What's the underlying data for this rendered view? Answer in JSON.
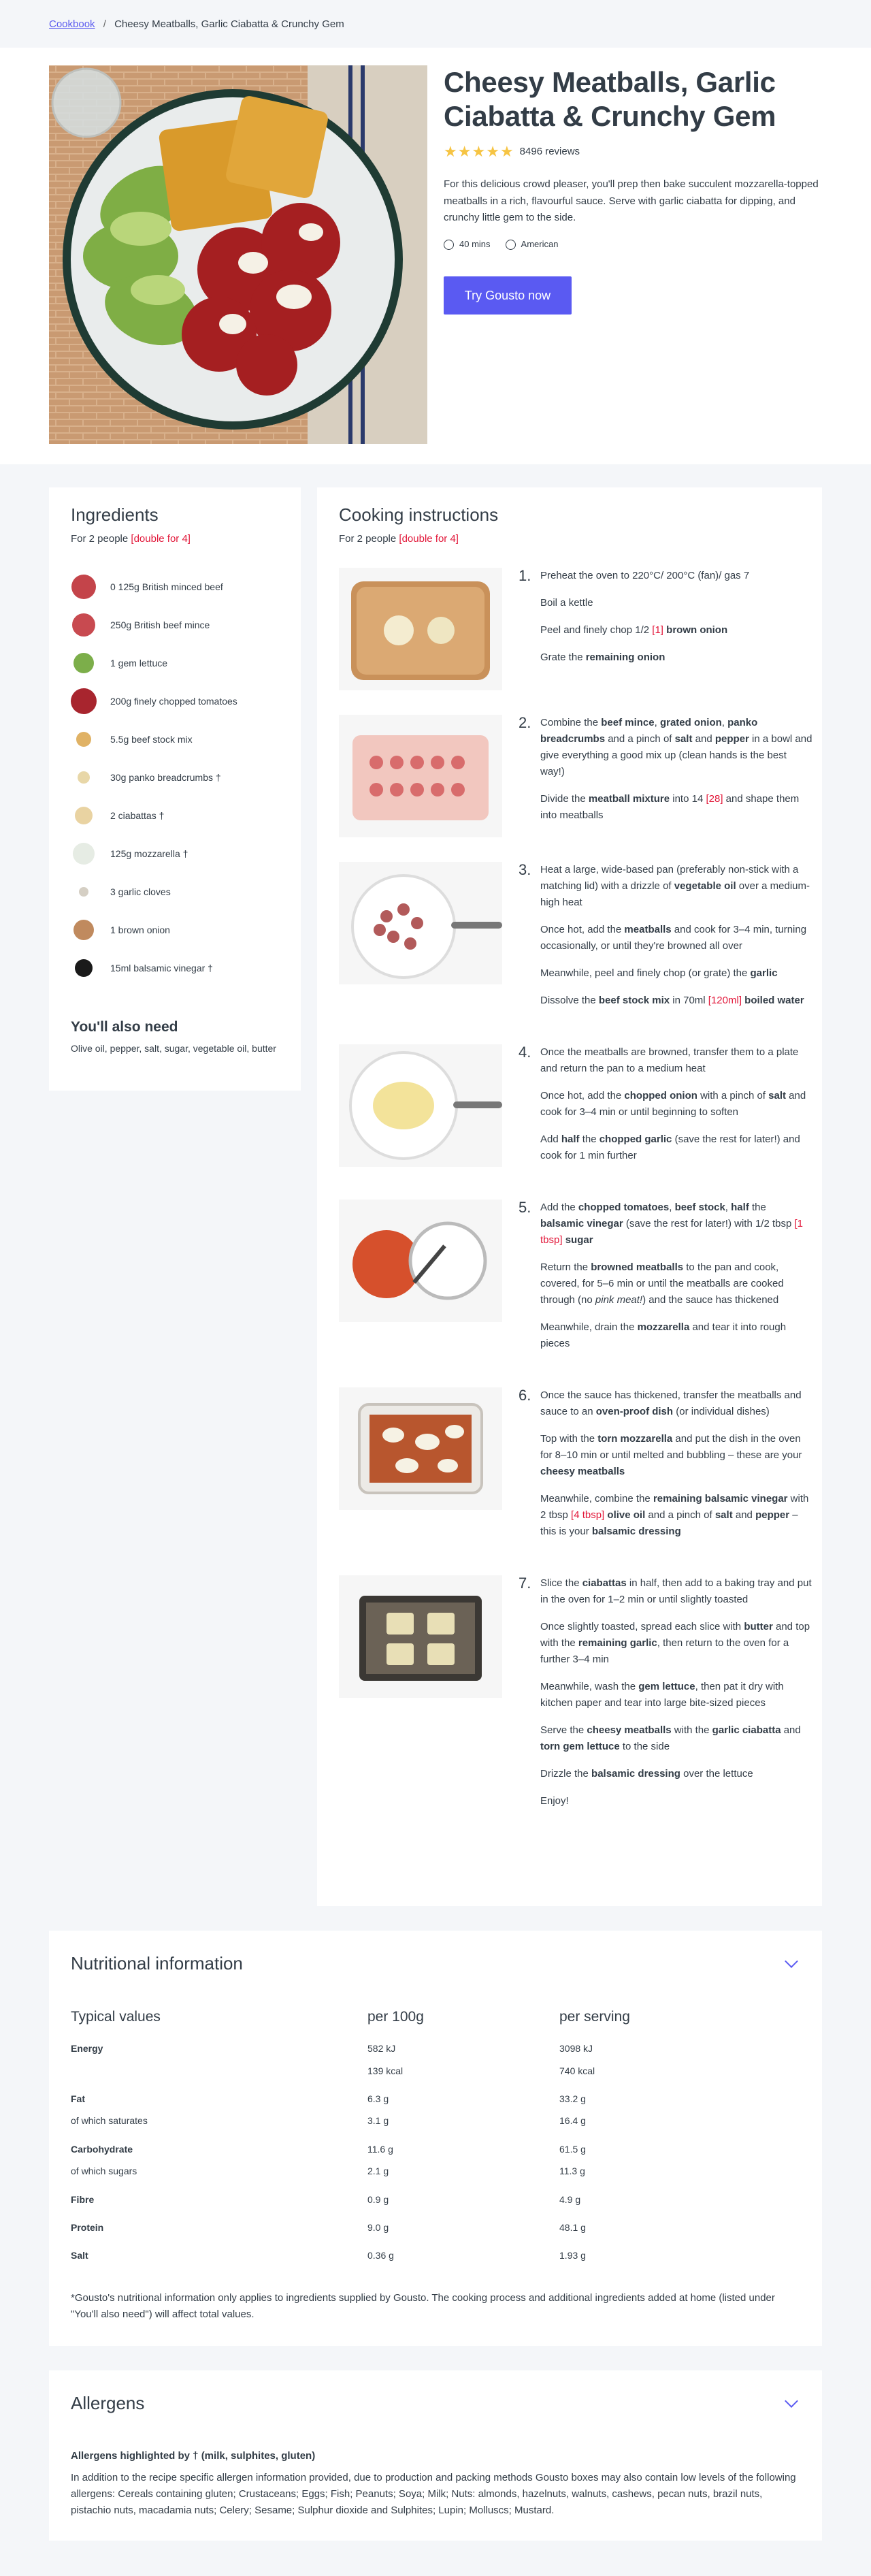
{
  "breadcrumb": {
    "link": "Cookbook",
    "sep": "/",
    "current": "Cheesy Meatballs, Garlic Ciabatta & Crunchy Gem"
  },
  "hero": {
    "title": "Cheesy Meatballs, Garlic Ciabatta & Crunchy Gem",
    "stars": 5,
    "reviews": "8496 reviews",
    "description": "For this delicious crowd pleaser, you'll prep then bake succulent mozzarella-topped meatballs in a rich, flavourful sauce. Serve with garlic ciabatta for dipping, and crunchy little gem to the side.",
    "time": "40 mins",
    "cuisine": "American",
    "button": "Try Gousto now"
  },
  "ingredients": {
    "title": "Ingredients",
    "people": "For 2 people",
    "double": "[double for 4]",
    "items": [
      {
        "label": "0 125g British minced beef",
        "color": "#c4444a"
      },
      {
        "label": "250g British beef mince",
        "color": "#c84a50"
      },
      {
        "label": "1 gem lettuce",
        "color": "#7cae4a"
      },
      {
        "label": "200g finely chopped tomatoes",
        "color": "#a8252e"
      },
      {
        "label": "5.5g beef stock mix",
        "color": "#e0b265"
      },
      {
        "label": "30g panko breadcrumbs †",
        "color": "#e8d7a8"
      },
      {
        "label": "2 ciabattas †",
        "color": "#e9d3a2"
      },
      {
        "label": "125g mozzarella †",
        "color": "#e6ece4"
      },
      {
        "label": "3 garlic cloves",
        "color": "#d5cfc4"
      },
      {
        "label": "1 brown onion",
        "color": "#c08a5e"
      },
      {
        "label": "15ml balsamic vinegar †",
        "color": "#1a1a1a"
      }
    ],
    "also_title": "You'll also need",
    "also_text": "Olive oil, pepper, salt, sugar, vegetable oil, butter"
  },
  "instructions": {
    "title": "Cooking instructions",
    "people": "For 2 people",
    "double": "[double for 4]",
    "steps": [
      {
        "num": "1.",
        "paras": [
          "Preheat the oven to 220°C/ 200°C (fan)/ gas 7",
          "Boil a kettle",
          "Peel and finely chop 1/2 <span class=\"double\">[1]</span> <b>brown onion</b>",
          "Grate the <b>remaining onion</b>"
        ]
      },
      {
        "num": "2.",
        "paras": [
          "Combine the <b>beef mince</b>, <b>grated onion</b>, <b>panko breadcrumbs</b> and a pinch of <b>salt</b> and <b>pepper</b> in a bowl and give everything a good mix up (clean hands is the best way!)",
          "Divide the <b>meatball mixture</b> into 14 <span class=\"double\">[28]</span> and shape them into meatballs"
        ]
      },
      {
        "num": "3.",
        "paras": [
          "Heat a large, wide-based pan (preferably non-stick with a matching lid) with a drizzle of <b>vegetable oil</b> over a medium-high heat",
          "Once hot, add the <b>meatballs</b> and cook for 3–4 min, turning occasionally, or until they're browned all over",
          "Meanwhile, peel and finely chop (or grate) the <b>garlic</b>",
          "Dissolve the <b>beef stock mix</b> in 70ml <span class=\"double\">[120ml]</span> <b>boiled water</b>"
        ]
      },
      {
        "num": "4.",
        "paras": [
          "Once the meatballs are browned, transfer them to a plate and return the pan to a medium heat",
          "Once hot, add the <b>chopped onion</b> with a pinch of <b>salt</b> and cook for 3–4 min or until beginning to soften",
          "Add <b>half</b> the <b>chopped garlic</b> (save the rest for later!) and cook for 1 min further"
        ]
      },
      {
        "num": "5.",
        "paras": [
          "Add the <b>chopped tomatoes</b>, <b>beef stock</b>, <b>half</b> the <b>balsamic vinegar</b> (save the rest for later!) with 1/2 tbsp <span class=\"double\">[1 tbsp]</span> <b>sugar</b>",
          "Return the <b>browned meatballs</b> to the pan and cook, covered, for 5–6 min or until the meatballs are cooked through (no <i>pink meat!</i>) and the sauce has thickened",
          "Meanwhile, drain the <b>mozzarella</b> and tear it into rough pieces"
        ]
      },
      {
        "num": "6.",
        "paras": [
          "Once the sauce has thickened, transfer the meatballs and sauce to an <b>oven-proof dish</b> (or individual dishes)",
          "Top with the <b>torn mozzarella</b> and put the dish in the oven for 8–10 min or until melted and bubbling – these are your <b>cheesy meatballs</b>",
          "Meanwhile, combine the <b>remaining balsamic vinegar</b> with 2 tbsp <span class=\"double\">[4 tbsp]</span> <b>olive oil</b> and a pinch of <b>salt</b> and <b>pepper</b> – this is your <b>balsamic dressing</b>"
        ]
      },
      {
        "num": "7.",
        "paras": [
          "Slice the <b>ciabattas</b> in half, then add to a baking tray and put in the oven for 1–2 min or until slightly toasted",
          "Once slightly toasted, spread each slice with <b>butter</b> and top with the <b>remaining garlic</b>, then return to the oven for a further 3–4 min",
          "Meanwhile, wash the <b>gem lettuce</b>, then pat it dry with kitchen paper and tear into large bite-sized pieces",
          "Serve the <b>cheesy meatballs</b> with the <b>garlic ciabatta</b> and <b>torn gem lettuce</b> to the side",
          "Drizzle the <b>balsamic dressing</b> over the lettuce",
          "Enjoy!"
        ]
      }
    ]
  },
  "nutrition": {
    "title": "Nutritional information",
    "headers": [
      "Typical values",
      "per 100g",
      "per serving"
    ],
    "rows": [
      {
        "label": "Energy",
        "bold": true,
        "a": "582 kJ",
        "b": "3098 kJ"
      },
      {
        "label": "",
        "bold": false,
        "a": "139 kcal",
        "b": "740 kcal"
      },
      {
        "label": "Fat",
        "bold": true,
        "a": "6.3 g",
        "b": "33.2 g"
      },
      {
        "label": "of which saturates",
        "bold": false,
        "a": "3.1 g",
        "b": "16.4 g"
      },
      {
        "label": "Carbohydrate",
        "bold": true,
        "a": "11.6 g",
        "b": "61.5 g"
      },
      {
        "label": "of which sugars",
        "bold": false,
        "a": "2.1 g",
        "b": "11.3 g"
      },
      {
        "label": "Fibre",
        "bold": true,
        "a": "0.9 g",
        "b": "4.9 g"
      },
      {
        "label": "Protein",
        "bold": true,
        "a": "9.0 g",
        "b": "48.1 g"
      },
      {
        "label": "Salt",
        "bold": true,
        "a": "0.36 g",
        "b": "1.93 g"
      }
    ],
    "footnote": "*Gousto's nutritional information only applies to ingredients supplied by Gousto. The cooking process and additional ingredients added at home (listed under \"You'll also need\") will affect total values."
  },
  "allergens": {
    "title": "Allergens",
    "highlight": "Allergens highlighted by † (milk, sulphites, gluten)",
    "text": "In addition to the recipe specific allergen information provided, due to production and packing methods Gousto boxes may also contain low levels of the following allergens: Cereals containing gluten; Crustaceans; Eggs; Fish; Peanuts; Soya; Milk; Nuts: almonds, hazelnuts, walnuts, cashews, pecan nuts, brazil nuts, pistachio nuts, macadamia nuts; Celery; Sesame; Sulphur dioxide and Sulphites; Lupin; Molluscs; Mustard."
  }
}
